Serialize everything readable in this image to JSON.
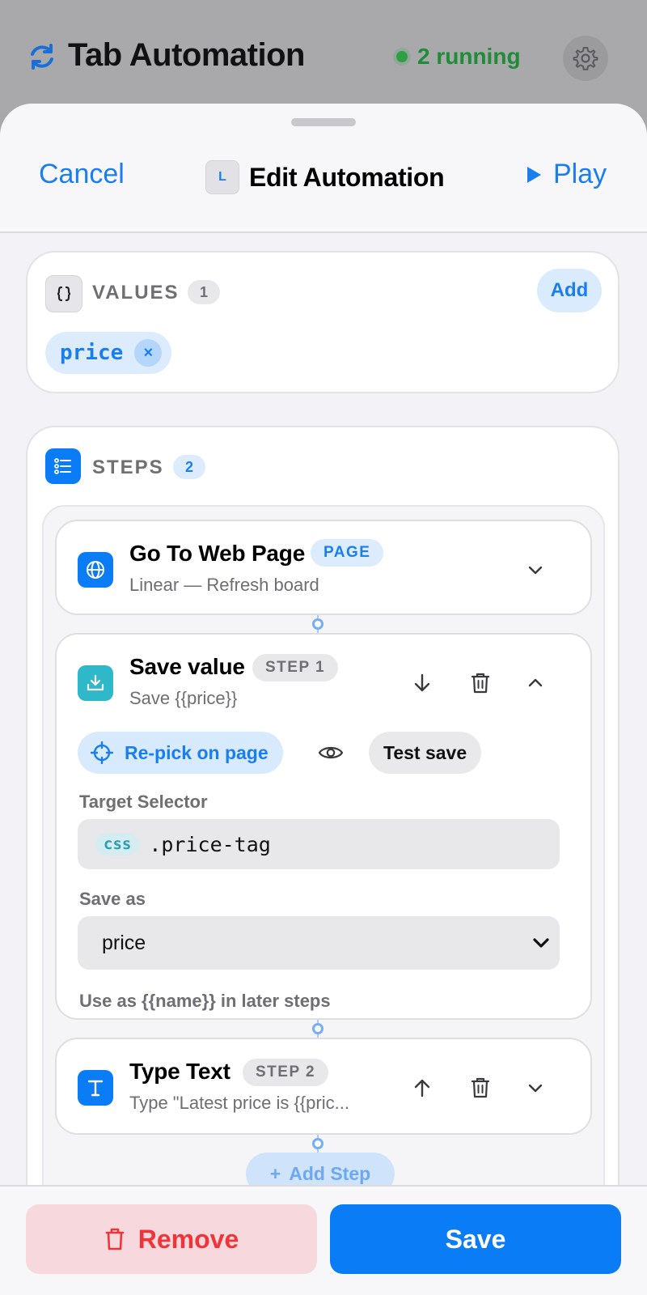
{
  "app": {
    "title": "Tab Automation",
    "running_status": "2 running"
  },
  "sheet": {
    "cancel_label": "Cancel",
    "title_badge": "L",
    "title": "Edit Automation",
    "play_label": "Play"
  },
  "values_section": {
    "label": "VALUES",
    "count": "1",
    "add_label": "Add",
    "chips": [
      {
        "label": "price",
        "remove_glyph": "×"
      }
    ]
  },
  "steps_section": {
    "label": "STEPS",
    "count": "2",
    "steps": [
      {
        "title": "Go To Web Page",
        "tag": "PAGE",
        "subtitle": "Linear — Refresh board"
      },
      {
        "title": "Save value",
        "tag": "STEP 1",
        "subtitle": "Save {{price}}",
        "repick_label": "Re-pick on page",
        "test_label": "Test save",
        "target_selector_label": "Target Selector",
        "selector_type": "css",
        "selector_value": ".price-tag",
        "save_as_label": "Save as",
        "save_as_value": "price",
        "hint": "Use as {{name}} in later steps"
      },
      {
        "title": "Type Text",
        "tag": "STEP 2",
        "subtitle": "Type \"Latest price is {{pric..."
      }
    ],
    "add_step_label": "Add Step"
  },
  "footer": {
    "remove_label": "Remove",
    "save_label": "Save"
  },
  "colors": {
    "accent": "#0a7cf5",
    "danger": "#f0353a",
    "running": "#1f8c37",
    "teal": "#2aa0b3"
  },
  "icons": {
    "sync": "sync-icon",
    "gear": "gear-icon",
    "play": "play-icon",
    "values": "braces-icon",
    "steps": "list-icon",
    "globe": "globe-icon",
    "download": "download-icon",
    "text": "text-icon",
    "chevron_down": "chevron-down-icon",
    "chevron_up": "chevron-up-icon",
    "arrow_down": "arrow-down-icon",
    "arrow_up": "arrow-up-icon",
    "trash": "trash-icon",
    "crosshair": "crosshair-icon",
    "eye": "eye-icon"
  }
}
